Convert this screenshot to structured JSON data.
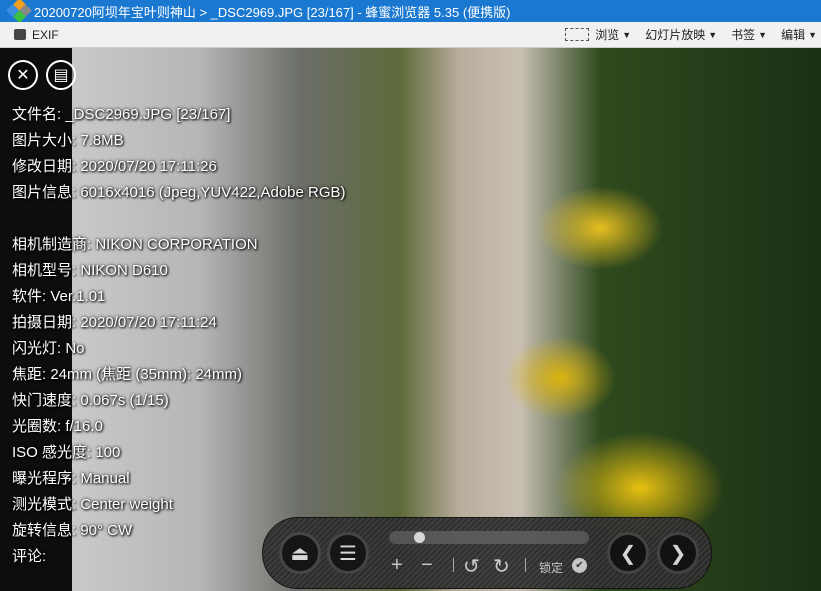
{
  "window": {
    "title": "20200720阿坝年宝叶则神山 > _DSC2969.JPG [23/167] - 蜂蜜浏览器 5.35 (便携版)"
  },
  "toolbar": {
    "exif": "EXIF",
    "browse": "浏览",
    "slideshow": "幻灯片放映",
    "bookmarks": "书签",
    "edit": "编辑"
  },
  "info": [
    "文件名: _DSC2969.JPG [23/167]",
    "图片大小: 7.8MB",
    "修改日期: 2020/07/20 17:11:26",
    "图片信息: 6016x4016 (Jpeg,YUV422,Adobe RGB)",
    "",
    "相机制造商: NIKON CORPORATION",
    "相机型号: NIKON D610",
    "软件: Ver.1.01",
    "拍摄日期: 2020/07/20 17:11:24",
    "闪光灯: No",
    "焦距: 24mm (焦距 (35mm): 24mm)",
    "快门速度: 0.067s (1/15)",
    "光圈数: f/16.0",
    "ISO 感光度: 100",
    "曝光程序: Manual",
    "测光模式: Center weight",
    "旋转信息: 90° CW",
    "评论:"
  ],
  "controls": {
    "lock_label": "锁定",
    "slider_position": 0.13
  }
}
